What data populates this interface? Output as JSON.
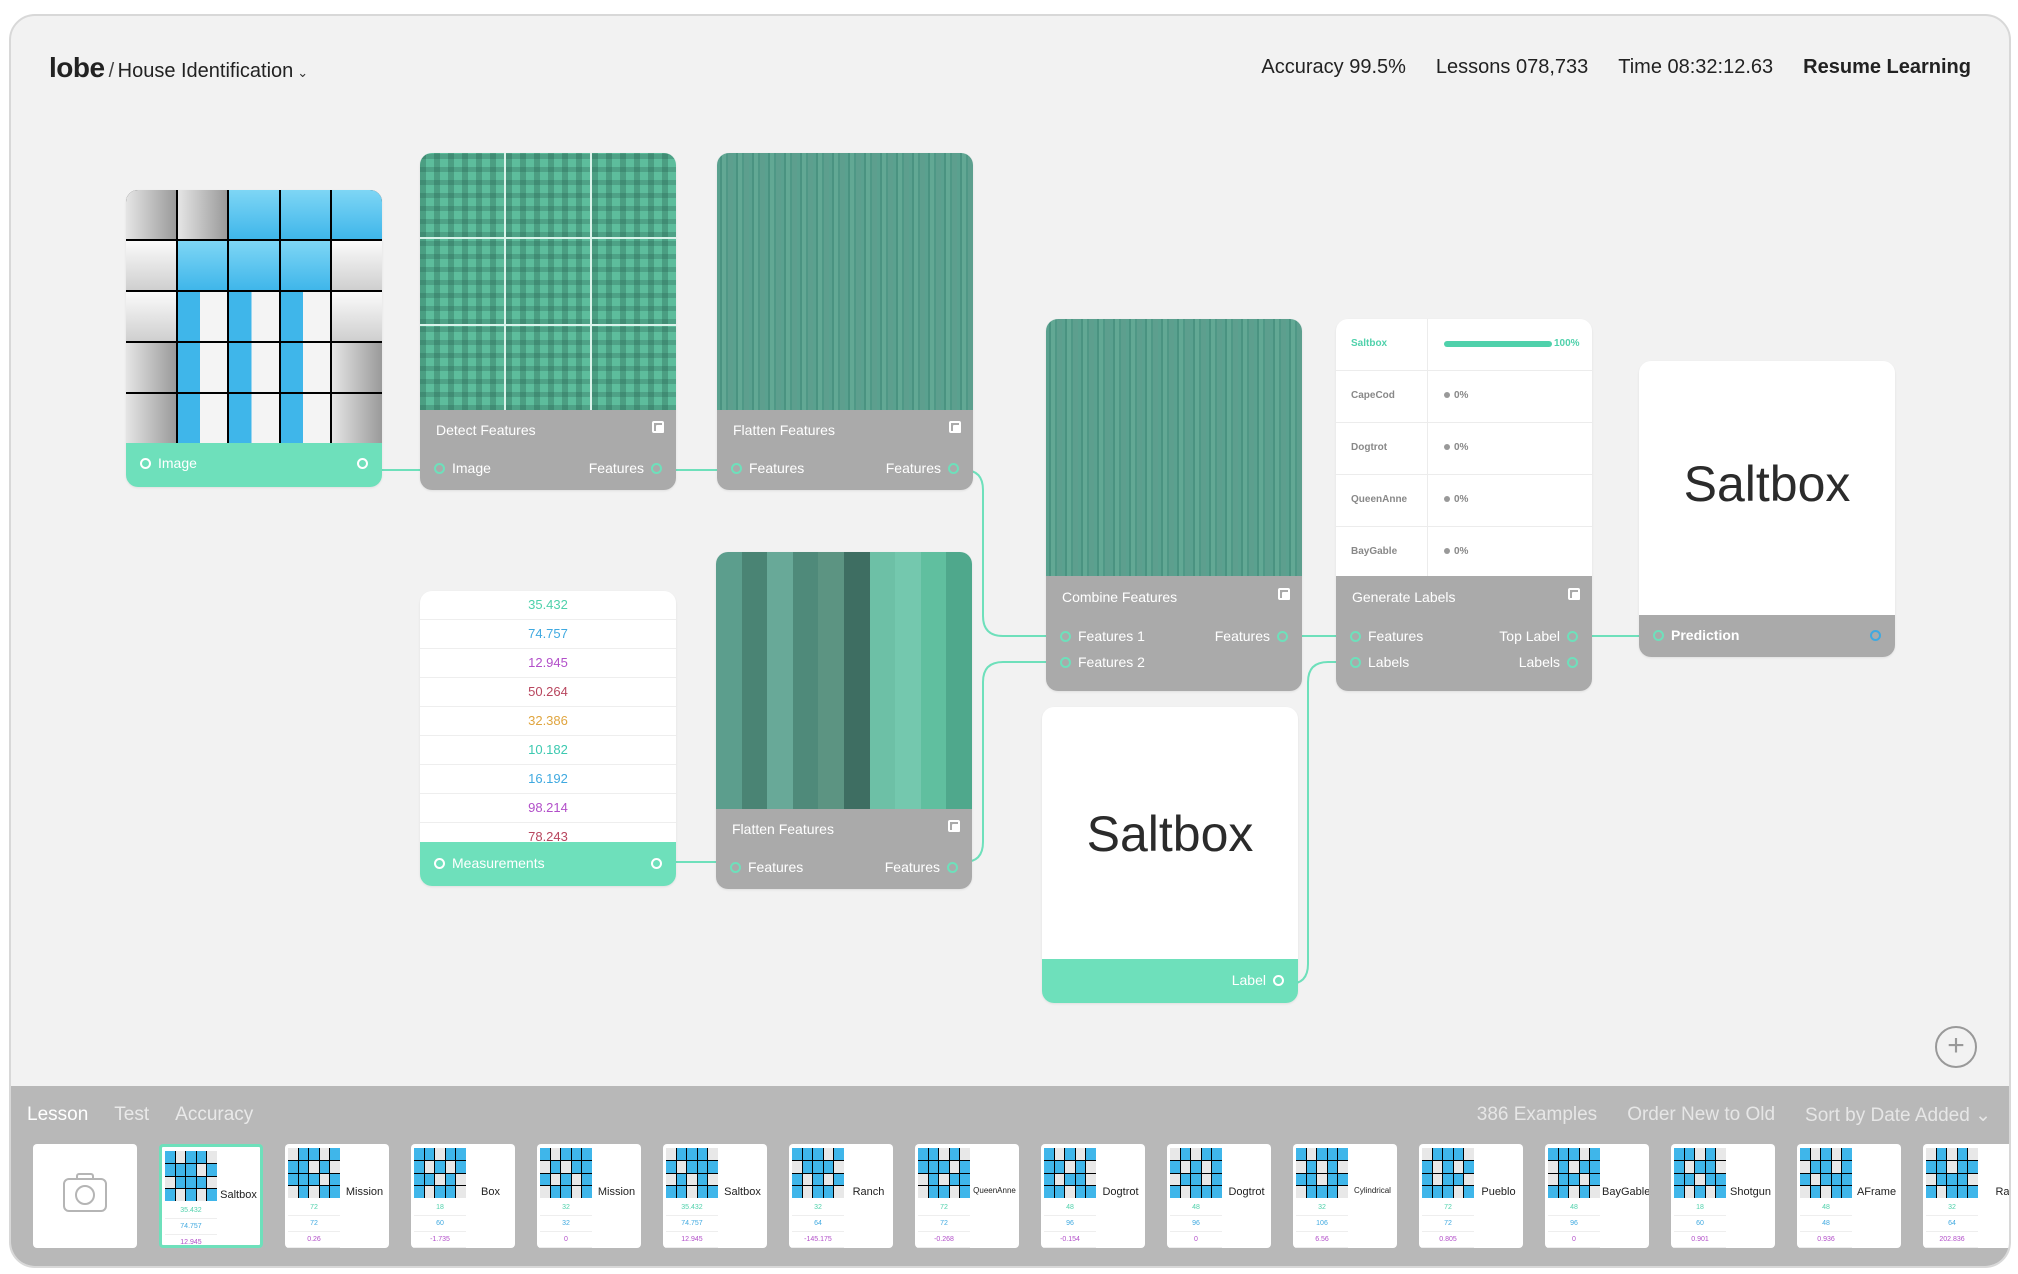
{
  "header": {
    "brand": "lobe",
    "separator": "/",
    "project": "House Identification",
    "project_chevron": "⌄",
    "accuracy": "Accuracy 99.5%",
    "lessons": "Lessons 078,733",
    "time": "Time 08:32:12.63",
    "resume": "Resume Learning"
  },
  "colors": {
    "accent": "#6ee0bb",
    "node_footer": "#aaaaaa",
    "wire": "#6ee0bb"
  },
  "nodes": {
    "image": {
      "port_out": "Image"
    },
    "detect": {
      "title": "Detect Features",
      "in": "Image",
      "out": "Features"
    },
    "flatten1": {
      "title": "Flatten Features",
      "in": "Features",
      "out": "Features"
    },
    "measurements": {
      "values": [
        "35.432",
        "74.757",
        "12.945",
        "50.264",
        "32.386",
        "10.182",
        "16.192",
        "98.214",
        "78.243"
      ],
      "value_colors": [
        "#4fd1ab",
        "#3fa9e0",
        "#b24fc9",
        "#b8465e",
        "#e0a53f",
        "#3cc9b0",
        "#3fa9e0",
        "#b24fc9",
        "#b8465e"
      ],
      "port_out": "Measurements"
    },
    "flatten2": {
      "title": "Flatten Features",
      "in": "Features",
      "out": "Features"
    },
    "combine": {
      "title": "Combine Features",
      "in1": "Features 1",
      "in2": "Features 2",
      "out": "Features"
    },
    "label": {
      "word": "Saltbox",
      "port_out": "Label"
    },
    "generate": {
      "title": "Generate Labels",
      "in1": "Features",
      "in2": "Labels",
      "out1": "Top Label",
      "out2": "Labels",
      "rows": [
        {
          "name": "Saltbox",
          "pct": "100%",
          "fraction": 1.0
        },
        {
          "name": "CapeCod",
          "pct": "0%",
          "fraction": 0
        },
        {
          "name": "Dogtrot",
          "pct": "0%",
          "fraction": 0
        },
        {
          "name": "QueenAnne",
          "pct": "0%",
          "fraction": 0
        },
        {
          "name": "BayGable",
          "pct": "0%",
          "fraction": 0
        }
      ]
    },
    "prediction": {
      "word": "Saltbox",
      "port_in": "Prediction"
    }
  },
  "add_icon": "+",
  "lesson_bar": {
    "tabs": [
      "Lesson",
      "Test",
      "Accuracy"
    ],
    "examples": "386 Examples",
    "order": "Order New to Old",
    "sort": "Sort by Date Added",
    "sort_chevron": "⌄",
    "thumbnails": [
      {
        "label": "Saltbox",
        "nums": [
          "35.432",
          "74.757",
          "12.945"
        ]
      },
      {
        "label": "Mission",
        "nums": [
          "72",
          "72",
          "0.26"
        ]
      },
      {
        "label": "Box",
        "nums": [
          "18",
          "60",
          "-1.735"
        ]
      },
      {
        "label": "Mission",
        "nums": [
          "32",
          "32",
          "0"
        ]
      },
      {
        "label": "Saltbox",
        "nums": [
          "35.432",
          "74.757",
          "12.945"
        ]
      },
      {
        "label": "Ranch",
        "nums": [
          "32",
          "64",
          "-145.175"
        ]
      },
      {
        "label": "QueenAnne",
        "nums": [
          "72",
          "72",
          "-0.268"
        ]
      },
      {
        "label": "Dogtrot",
        "nums": [
          "48",
          "96",
          "-0.154"
        ]
      },
      {
        "label": "Dogtrot",
        "nums": [
          "48",
          "96",
          "0"
        ]
      },
      {
        "label": "Cylindrical",
        "nums": [
          "32",
          "106",
          "6.56"
        ]
      },
      {
        "label": "Pueblo",
        "nums": [
          "72",
          "72",
          "0.805"
        ]
      },
      {
        "label": "BayGable",
        "nums": [
          "48",
          "96",
          "0"
        ]
      },
      {
        "label": "Shotgun",
        "nums": [
          "18",
          "60",
          "0.901"
        ]
      },
      {
        "label": "AFrame",
        "nums": [
          "48",
          "48",
          "0.936"
        ]
      },
      {
        "label": "Ra",
        "nums": [
          "32",
          "64",
          "202.836"
        ]
      }
    ]
  }
}
